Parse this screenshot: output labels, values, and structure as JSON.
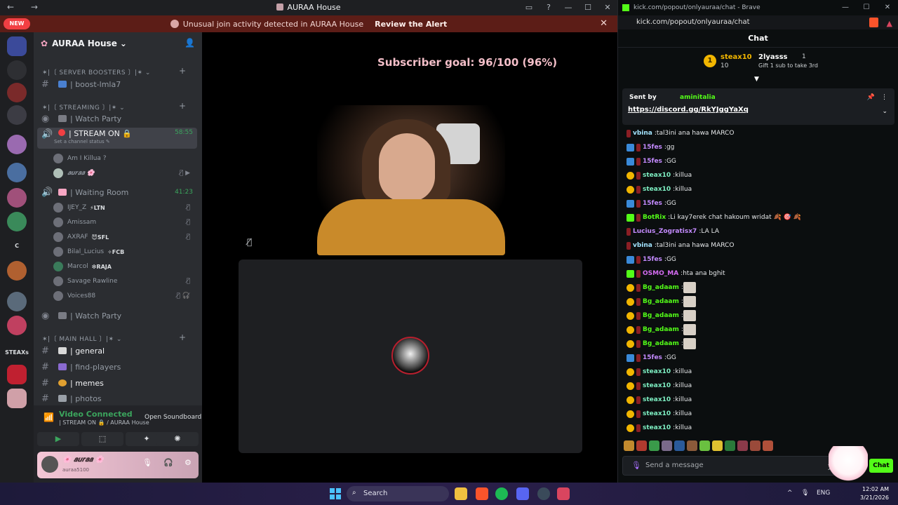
{
  "discord": {
    "nav": "← →",
    "title": "AURAA House",
    "window_controls": [
      "▭",
      "?",
      "—",
      "☐",
      "✕"
    ],
    "alert": {
      "message": "Unusual join activity detected in AURAA House",
      "action": "Review the Alert",
      "close": "✕"
    },
    "servers": {
      "new_badge": "NEW",
      "label_c": "C",
      "label_steaxs": "STEAXs"
    },
    "server_name": "AURAA House",
    "server_chevron": "⌄",
    "categories": {
      "boosters": "✶|〔 SERVER BOOSTERS 〕|✶ ⌄",
      "streaming": "✶|〔 STREAMING 〕|✶ ⌄",
      "main_hall": "✶|〔 MAIN HALL 〕|✶ ⌄"
    },
    "plus": "+",
    "channels": {
      "boost": "| boost-lmla7",
      "watch_party_1": "| Watch Party",
      "stream_on": "| STREAM ON 🔒",
      "stream_time": "58:55",
      "stream_status": "Set a channel status ✎",
      "waiting_room": "| Waiting Room",
      "waiting_time": "41:23",
      "watch_party_2": "| Watch Party",
      "general": "| general",
      "find_players": "| find-players",
      "memes": "| memes",
      "photos": "| photos"
    },
    "stream_users": [
      "Am I Killua ?",
      "𝒂𝒖𝒓𝒂𝒂 🌸"
    ],
    "waiting_users": [
      {
        "name": "IJEY_Z",
        "tag": "⚡LTN"
      },
      {
        "name": "Amissam",
        "tag": ""
      },
      {
        "name": "AXRAF",
        "tag": "😈SFL"
      },
      {
        "name": "Bilal_Lucius",
        "tag": "✧FCB"
      },
      {
        "name": "Marcol",
        "tag": "❇RAJA"
      },
      {
        "name": "Savage Rawline",
        "tag": ""
      },
      {
        "name": "Voices88",
        "tag": ""
      }
    ],
    "voice": {
      "connected": "Video Connected",
      "location": "| STREAM ON 🔒 / AURAA House",
      "soundboard": "Open Soundboard",
      "buttons": [
        "▶",
        "⬚",
        "✦",
        "✺"
      ]
    },
    "me": {
      "display_name": "🌸 𝒂𝒖𝒓𝒂𝒂 🌸",
      "username": "auraa5100",
      "icons": [
        "🎙",
        "🎧",
        "⚙"
      ]
    },
    "stage": {
      "subscriber_goal": "Subscriber goal: 96/100 (96%)",
      "muted_icon": "🎙̸"
    }
  },
  "kick": {
    "tab_url": "kick.com/popout/onlyauraa/chat - Brave",
    "window_controls": [
      "—",
      "☐",
      "✕"
    ],
    "address": "kick.com/popout/onlyauraa/chat",
    "chat_title": "Chat",
    "gifters": {
      "rank": "1",
      "first_name": "steax10",
      "first_count": "10",
      "second_name": "2lyasss",
      "second_count": "1",
      "prompt": "Gift 1 sub to take 3rd",
      "expand": "▼"
    },
    "pinned": {
      "sent_by": "Sent by",
      "author": "aminitalia",
      "link": "https://discord.gg/RkYJggYaXq",
      "pin": "📌",
      "more": "⋮",
      "down": "⌄"
    },
    "messages": [
      {
        "user": "vbina",
        "text": "tal3ini ana hawa MARCO",
        "color": "#a3e4ff",
        "badge": ""
      },
      {
        "user": "15fes",
        "text": "gg",
        "color": "#c48bff",
        "badge": "#3a8ad9"
      },
      {
        "user": "15fes",
        "text": "GG",
        "color": "#c48bff",
        "badge": "#3a8ad9"
      },
      {
        "user": "steax10",
        "text": "killua",
        "color": "#7ef0c3",
        "badge": "#f2b600"
      },
      {
        "user": "steax10",
        "text": "killua",
        "color": "#7ef0c3",
        "badge": "#f2b600"
      },
      {
        "user": "15fes",
        "text": "GG",
        "color": "#c48bff",
        "badge": "#3a8ad9"
      },
      {
        "user": "BotRix",
        "text": "Li kay7erek chat hakoum wridat 🍂 🎯 🍂",
        "color": "#53fc18",
        "badge": "#53fc18"
      },
      {
        "user": "Lucius_Zogratisx7",
        "text": "LA LA",
        "color": "#c48bff",
        "badge": ""
      },
      {
        "user": "vbina",
        "text": "tal3ini ana hawa MARCO",
        "color": "#a3e4ff",
        "badge": ""
      },
      {
        "user": "15fes",
        "text": "GG",
        "color": "#c48bff",
        "badge": "#3a8ad9"
      },
      {
        "user": "OSMO_MA",
        "text": "hta ana bghit",
        "color": "#d56cf2",
        "badge": "#53fc18"
      },
      {
        "user": "Bg_adaam",
        "text": "",
        "color": "#53fc18",
        "badge": "#f2b600"
      },
      {
        "user": "Bg_adaam",
        "text": "",
        "color": "#53fc18",
        "badge": "#f2b600"
      },
      {
        "user": "Bg_adaam",
        "text": "",
        "color": "#53fc18",
        "badge": "#f2b600"
      },
      {
        "user": "Bg_adaam",
        "text": "",
        "color": "#53fc18",
        "badge": "#f2b600"
      },
      {
        "user": "Bg_adaam",
        "text": "",
        "color": "#53fc18",
        "badge": "#f2b600"
      },
      {
        "user": "15fes",
        "text": "GG",
        "color": "#c48bff",
        "badge": "#3a8ad9"
      },
      {
        "user": "steax10",
        "text": "killua",
        "color": "#7ef0c3",
        "badge": "#f2b600"
      },
      {
        "user": "steax10",
        "text": "killua",
        "color": "#7ef0c3",
        "badge": "#f2b600"
      },
      {
        "user": "steax10",
        "text": "killua",
        "color": "#7ef0c3",
        "badge": "#f2b600"
      },
      {
        "user": "steax10",
        "text": "killua",
        "color": "#7ef0c3",
        "badge": "#f2b600"
      },
      {
        "user": "steax10",
        "text": "killua",
        "color": "#7ef0c3",
        "badge": "#f2b600"
      }
    ],
    "input": {
      "placeholder": "Send a message",
      "emote_icon": "☺",
      "translate_icon": "文"
    },
    "chat_button": "Chat"
  },
  "taskbar": {
    "search": "Search",
    "search_icon": "⌕",
    "tray_up": "^",
    "lang": "ENG",
    "time": "12:02 AM",
    "date": "3/21/2026"
  },
  "colors": {
    "discord_bg": "#1e1f22",
    "sidebar_bg": "#2b2d31",
    "kick_green": "#53fc18",
    "alert_red": "#5c1d17",
    "voice_green": "#3ba55d"
  }
}
